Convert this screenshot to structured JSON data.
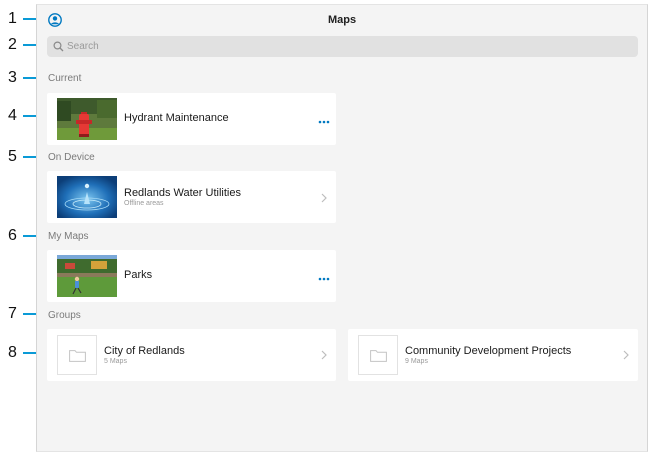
{
  "callouts": [
    "1",
    "2",
    "3",
    "4",
    "5",
    "6",
    "7",
    "8"
  ],
  "header": {
    "title": "Maps",
    "profile_icon": "user-circle-icon"
  },
  "search": {
    "placeholder": "Search",
    "value": ""
  },
  "sections": {
    "current": "Current",
    "on_device": "On Device",
    "my_maps": "My Maps",
    "groups": "Groups"
  },
  "current_map": {
    "title": "Hydrant Maintenance",
    "thumbnail": "hydrant-photo",
    "action_icon": "more-dots-icon"
  },
  "on_device_map": {
    "title": "Redlands Water Utilities",
    "subtitle": "Offline areas",
    "thumbnail": "water-drop-photo",
    "action_icon": "chevron-right-icon"
  },
  "my_maps": [
    {
      "title": "Parks",
      "thumbnail": "park-photo",
      "action_icon": "more-dots-icon"
    }
  ],
  "groups": [
    {
      "title": "City of Redlands",
      "subtitle": "5 Maps",
      "icon": "folder-icon"
    },
    {
      "title": "Community Development Projects",
      "subtitle": "9 Maps",
      "icon": "folder-icon"
    }
  ],
  "colors": {
    "accent": "#0079c1",
    "callout": "#0a9ad6",
    "background": "#f4f4f4",
    "card": "#ffffff"
  }
}
